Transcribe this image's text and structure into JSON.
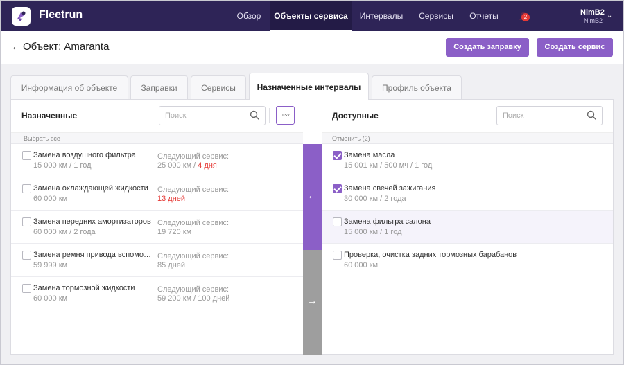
{
  "brand": {
    "name": "Fleetrun"
  },
  "nav": {
    "items": [
      {
        "label": "Обзор"
      },
      {
        "label": "Объекты сервиса"
      },
      {
        "label": "Интервалы"
      },
      {
        "label": "Сервисы"
      },
      {
        "label": "Отчеты"
      }
    ],
    "active_index": 1,
    "notifications_count": "2",
    "user_name": "NimB2",
    "user_sub": "NimB2"
  },
  "header": {
    "back_icon": "arrow-left-icon",
    "title": "Объект: Amaranta",
    "btn_refuel": "Создать заправку",
    "btn_service": "Создать сервис"
  },
  "tabs": [
    {
      "label": "Информация об объекте"
    },
    {
      "label": "Заправки"
    },
    {
      "label": "Сервисы"
    },
    {
      "label": "Назначенные интервалы"
    },
    {
      "label": "Профиль объекта"
    }
  ],
  "active_tab": 3,
  "assigned": {
    "title": "Назначенные",
    "search_placeholder": "Поиск",
    "csv_label": ".csv",
    "select_all": "Выбрать все",
    "next_label": "Следующий сервис:",
    "rows": [
      {
        "title": "Замена воздушного фильтра",
        "sub": "15 000 км / 1 год",
        "next": "25 000 км / ",
        "next_red": "4 дня"
      },
      {
        "title": "Замена охлаждающей жидкости",
        "sub": "60 000 км",
        "next": "",
        "next_red": "13 дней"
      },
      {
        "title": "Замена передних амортизаторов",
        "sub": "60 000 км / 2 года",
        "next": "19 720 км",
        "next_red": ""
      },
      {
        "title": "Замена ремня привода вспомог…",
        "sub": "59 999 км",
        "next": "85 дней",
        "next_red": ""
      },
      {
        "title": "Замена тормозной жидкости",
        "sub": "60 000 км",
        "next": "59 200 км / 100 дней",
        "next_red": ""
      }
    ]
  },
  "available": {
    "title": "Доступные",
    "search_placeholder": "Поиск",
    "cancel": "Отменить (2)",
    "rows": [
      {
        "title": "Замена масла",
        "sub": "15 001 км / 500 мч / 1 год",
        "checked": true
      },
      {
        "title": "Замена свечей зажигания",
        "sub": "30 000 км / 2 года",
        "checked": true
      },
      {
        "title": "Замена фильтра салона",
        "sub": "15 000 км / 1 год",
        "checked": false
      },
      {
        "title": "Проверка, очистка задних тормозных барабанов",
        "sub": "60 000 км",
        "checked": false
      }
    ]
  },
  "colors": {
    "accent": "#8b5fc7",
    "topbar": "#2e2457",
    "warning": "#e53935"
  }
}
